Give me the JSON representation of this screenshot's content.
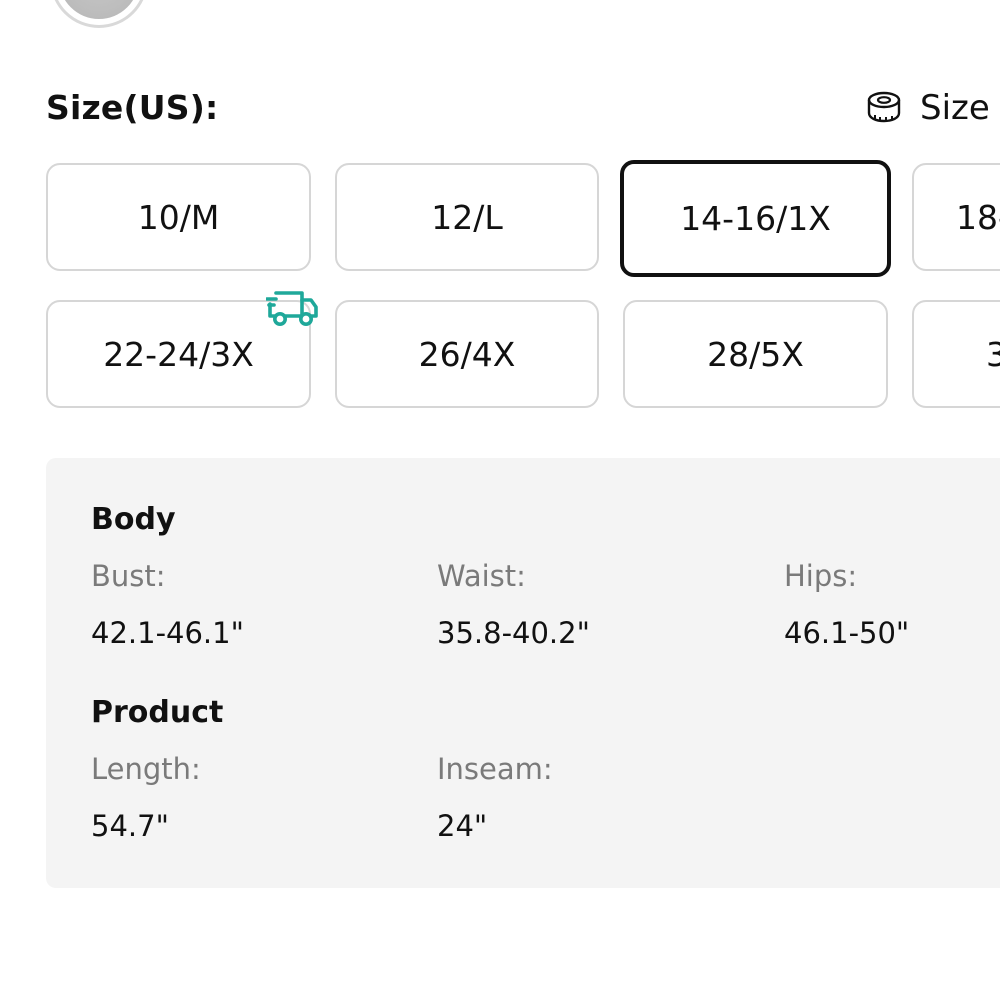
{
  "size_selector": {
    "title": "Size(US):",
    "size_guide_label": "Size",
    "options_row1": [
      {
        "label": "10/M",
        "selected": false
      },
      {
        "label": "12/L",
        "selected": false
      },
      {
        "label": "14-16/1X",
        "selected": true
      },
      {
        "label": "18-",
        "selected": false
      }
    ],
    "options_row2": [
      {
        "label": "22-24/3X",
        "selected": false,
        "badge": "fast-shipping-truck-icon"
      },
      {
        "label": "26/4X",
        "selected": false
      },
      {
        "label": "28/5X",
        "selected": false
      },
      {
        "label": "3",
        "selected": false
      }
    ],
    "accent_color": "#1fa89a"
  },
  "measurements": {
    "body": {
      "title": "Body",
      "items": [
        {
          "label": "Bust:",
          "value": "42.1-46.1\""
        },
        {
          "label": "Waist:",
          "value": "35.8-40.2\""
        },
        {
          "label": "Hips:",
          "value": "46.1-50\""
        }
      ]
    },
    "product": {
      "title": "Product",
      "items": [
        {
          "label": "Length:",
          "value": "54.7\""
        },
        {
          "label": "Inseam:",
          "value": "24\""
        }
      ]
    }
  }
}
